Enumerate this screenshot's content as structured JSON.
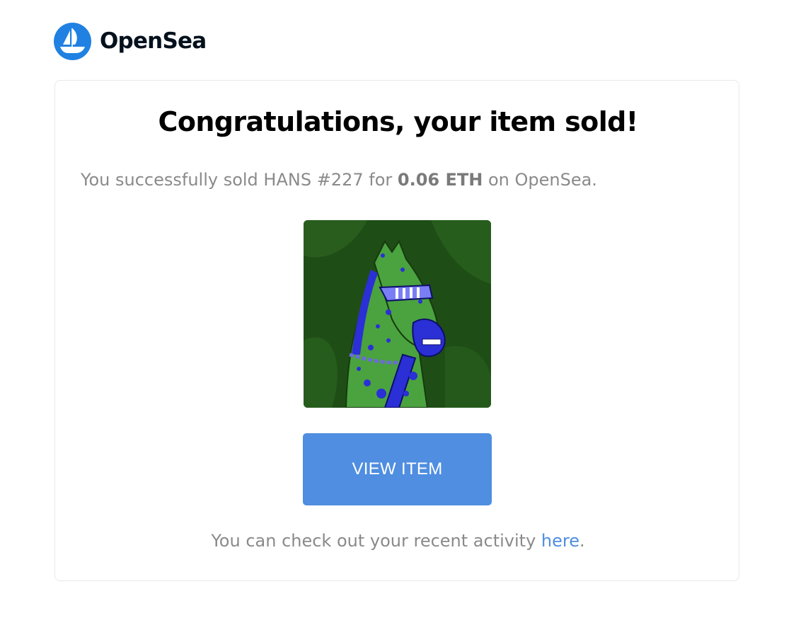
{
  "brand": {
    "name": "OpenSea",
    "logo_icon": "opensea-ship-icon",
    "logo_color": "#2081e2"
  },
  "email": {
    "title": "Congratulations, your item sold!",
    "summary": {
      "prefix": "You successfully sold HANS #227 for",
      "amount": "0.06 ETH",
      "suffix": "on OpenSea."
    },
    "item_image": {
      "subject": "green horse with blue spots wearing visor sunglasses and a chain necklace"
    },
    "cta": {
      "label": "VIEW ITEM",
      "color": "#4f8ee0"
    },
    "footer": {
      "prefix": "You can check out your recent activity",
      "link_label": "here",
      "suffix": "."
    }
  },
  "colors": {
    "muted_text": "#8a8a8a",
    "link": "#4f8ee0",
    "card_border": "#e5e8eb"
  }
}
